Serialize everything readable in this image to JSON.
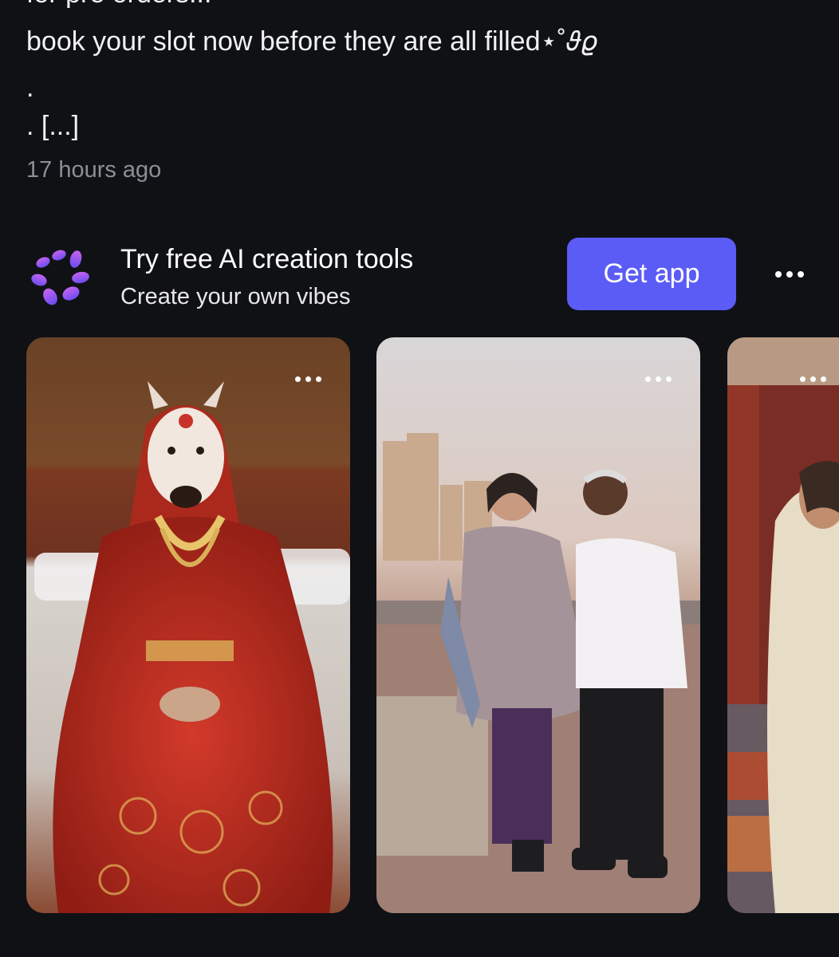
{
  "post": {
    "cut_line": "for pre orders!!!",
    "line1": "book your slot now before they are all filled⋆˚𝜗𝜚",
    "line2": ".",
    "line3": ". [...]",
    "timestamp": "17 hours ago"
  },
  "ad": {
    "logo_icon": "flower-petals-logo-icon",
    "title": "Try free AI creation tools",
    "subtitle": "Create your own vibes",
    "cta_label": "Get app",
    "more_icon": "more-horizontal-icon",
    "colors": {
      "cta_background": "#5b5cf6",
      "logo_purple": "#a35cf2",
      "logo_violet": "#6a4cf0"
    }
  },
  "carousel": {
    "cards": [
      {
        "image": "bride-in-red-lehenga-with-animal-mask",
        "more_icon": "more-horizontal-icon"
      },
      {
        "image": "couple-standing-on-seaside-promenade",
        "more_icon": "more-horizontal-icon"
      },
      {
        "image": "woman-among-colorful-textiles",
        "more_icon": "more-horizontal-icon"
      }
    ]
  },
  "theme": {
    "background": "#0f1115",
    "text_primary": "#f2f2f2",
    "text_muted": "#8c8f96"
  }
}
